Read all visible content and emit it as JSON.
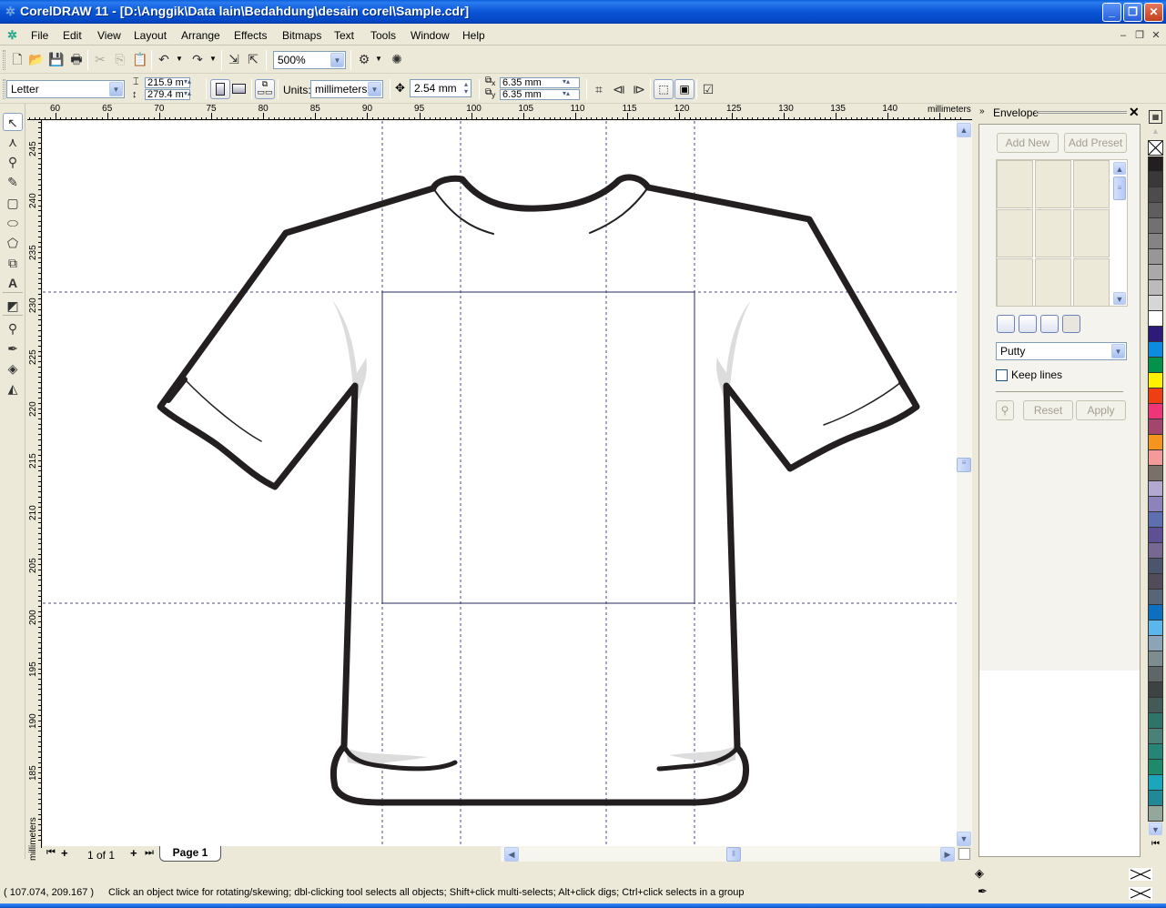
{
  "window": {
    "title": "CorelDRAW 11 - [D:\\Anggik\\Data lain\\Bedahdung\\desain corel\\Sample.cdr]",
    "minimize": "_",
    "maximize": "❐",
    "close": "✕"
  },
  "menu": {
    "items": [
      {
        "label": "File",
        "accel": "F"
      },
      {
        "label": "Edit",
        "accel": "E"
      },
      {
        "label": "View",
        "accel": "V"
      },
      {
        "label": "Layout",
        "accel": "L"
      },
      {
        "label": "Arrange",
        "accel": "A"
      },
      {
        "label": "Effects",
        "accel": "c"
      },
      {
        "label": "Bitmaps",
        "accel": "B"
      },
      {
        "label": "Text",
        "accel": "T"
      },
      {
        "label": "Tools",
        "accel": "o"
      },
      {
        "label": "Window",
        "accel": "W"
      },
      {
        "label": "Help",
        "accel": "H"
      }
    ],
    "doc_minimize": "–",
    "doc_restore": "❐",
    "doc_close": "✕"
  },
  "standard_toolbar": {
    "zoom_level": "500%",
    "icons": [
      "new-icon",
      "open-icon",
      "save-icon",
      "print-icon",
      "cut-icon",
      "copy-icon",
      "paste-icon",
      "undo-icon",
      "redo-icon",
      "import-icon",
      "export-icon",
      "application-launcher-icon",
      "corel-online-icon"
    ]
  },
  "property_bar": {
    "paper_size": "Letter",
    "paper_width": "215.9 m",
    "paper_height": "279.4 m",
    "units_label": "Units:",
    "units": "millimeters",
    "nudge": "2.54 mm",
    "duplicate_x": "6.35 mm",
    "duplicate_y": "6.35 mm",
    "x_sub": "x",
    "y_sub": "y"
  },
  "rulers": {
    "unit": "millimeters",
    "horizontal_ticks": [
      "60",
      "65",
      "70",
      "75",
      "80",
      "85",
      "90",
      "95",
      "100",
      "105",
      "110",
      "115",
      "120",
      "125",
      "130",
      "135",
      "140"
    ],
    "vertical_ticks": [
      "245",
      "240",
      "235",
      "230",
      "225",
      "220",
      "215",
      "210",
      "205",
      "200",
      "195",
      "190",
      "185"
    ]
  },
  "toolbox": {
    "tools": [
      "pick-tool",
      "shape-tool",
      "zoom-tool",
      "freehand-tool",
      "rectangle-tool",
      "ellipse-tool",
      "polygon-tool",
      "basic-shapes-tool",
      "text-tool",
      "interactive-tool",
      "eyedropper-tool",
      "outline-tool",
      "fill-tool",
      "interactive-fill-tool"
    ]
  },
  "page_nav": {
    "page_count": "1 of 1",
    "current_tab": "Page 1"
  },
  "docker": {
    "title": "Envelope",
    "add_new": "Add New",
    "add_preset": "Add Preset",
    "mode": "Putty",
    "keep_lines_label": "Keep lines",
    "keep_lines_checked": false,
    "reset": "Reset",
    "apply": "Apply"
  },
  "palette": {
    "colors": [
      "#231f20",
      "#3a3838",
      "#4d4b4b",
      "#5f5d5d",
      "#727070",
      "#858383",
      "#989696",
      "#aaa8a8",
      "#bcbaba",
      "#d7d6d6",
      "#ffffff",
      "#2e1a78",
      "#0c8be0",
      "#04924a",
      "#fff200",
      "#ed3f12",
      "#ee3578",
      "#a4456e",
      "#f7941d",
      "#f49a9a",
      "#79706a",
      "#b3a8d2",
      "#8e82bc",
      "#5d6fb0",
      "#5f5095",
      "#776893",
      "#4b556e",
      "#524c5a",
      "#566676",
      "#0d6fc0",
      "#5bb6ec",
      "#8ca4b8",
      "#7d8c8e",
      "#5e6667",
      "#3d4242",
      "#435a58",
      "#2f7369",
      "#4b8078",
      "#268577",
      "#1e8a6a",
      "#1aa7bb",
      "#218898",
      "#93a89b"
    ]
  },
  "status": {
    "coordinates": "( 107.074, 209.167 )",
    "hint": "Click an object twice for rotating/skewing; dbl-clicking tool selects all objects; Shift+click multi-selects; Alt+click digs; Ctrl+click selects in a group"
  },
  "colors": {
    "accent": "#0a55d6",
    "chrome": "#ece9d8",
    "guides": "#4a4a8a",
    "outline": "#231f20"
  }
}
